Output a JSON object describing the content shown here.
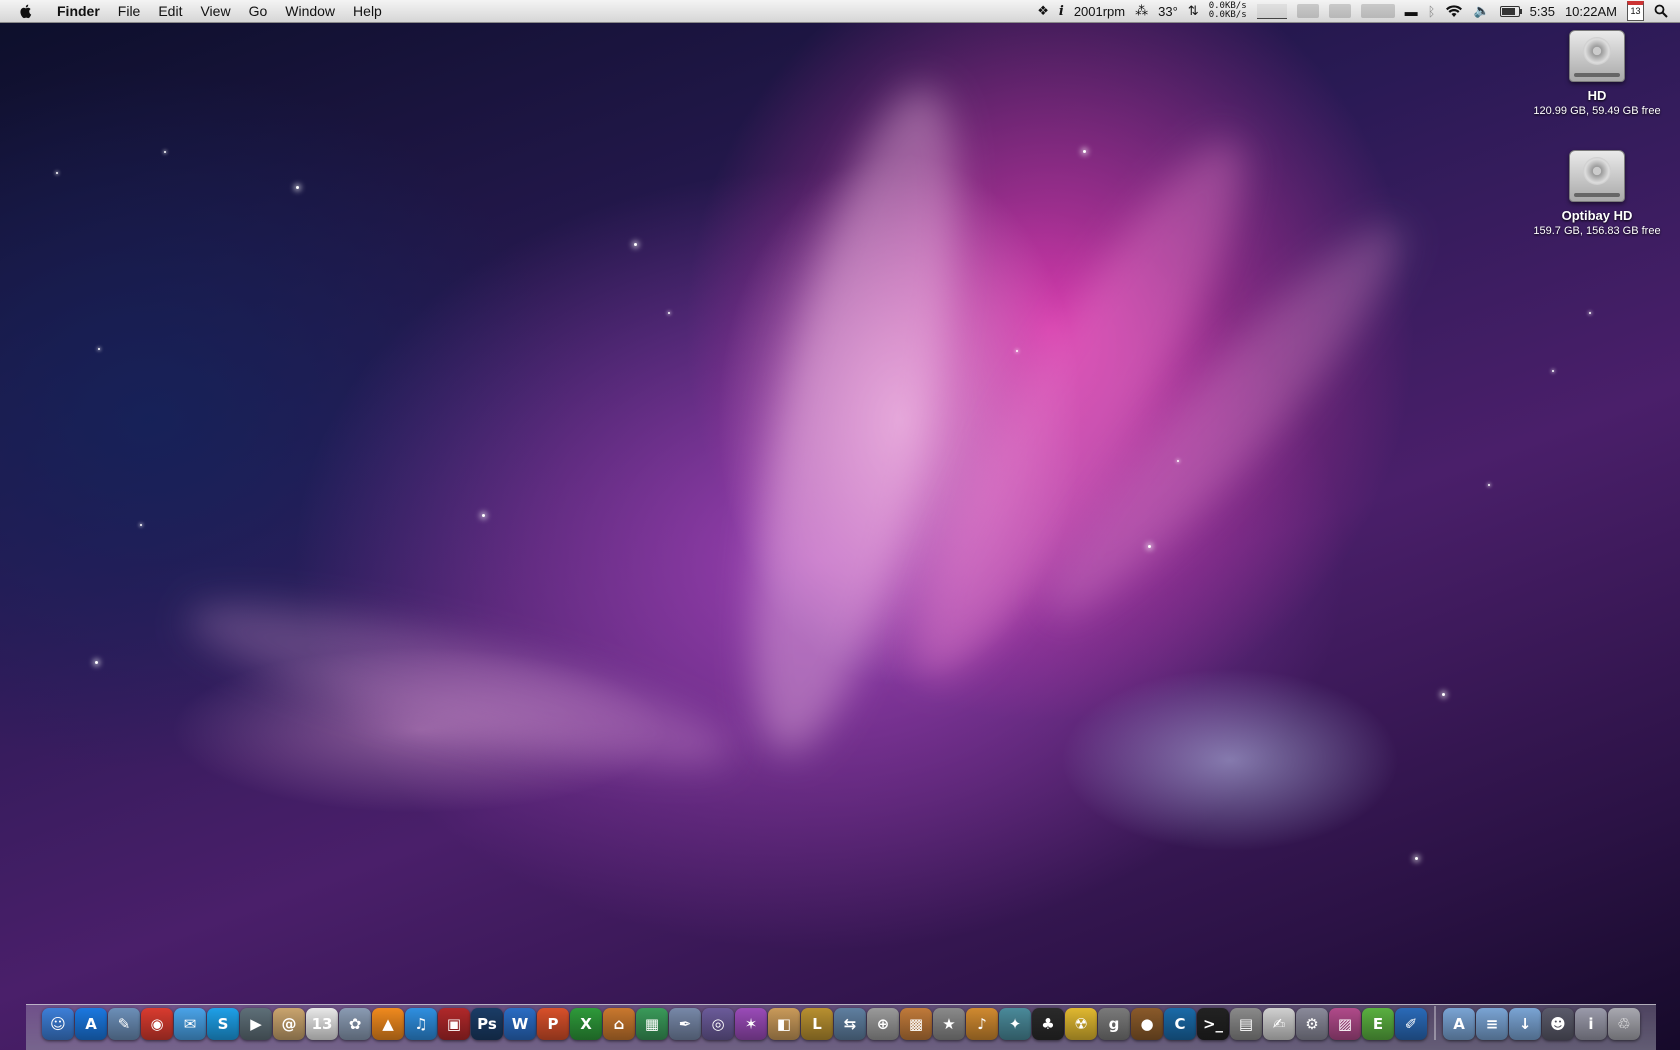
{
  "menubar": {
    "app_name": "Finder",
    "menus": [
      "File",
      "Edit",
      "View",
      "Go",
      "Window",
      "Help"
    ],
    "status": {
      "fan_speed": "2001rpm",
      "temperature": "33°",
      "net_up": "0.0KB/s",
      "net_down": "0.0KB/s",
      "battery_time": "5:35",
      "clock": "10:22AM",
      "calendar_day": "13"
    }
  },
  "desktop_icons": [
    {
      "name": "HD",
      "info": "120.99 GB, 59.49 GB free"
    },
    {
      "name": "Optibay HD",
      "info": "159.7 GB, 156.83 GB free"
    }
  ],
  "dock": {
    "apps": [
      {
        "name": "finder-icon",
        "glyph": "☺",
        "color": "#3d7fd8"
      },
      {
        "name": "app-store-icon",
        "glyph": "A",
        "color": "#1b78e0"
      },
      {
        "name": "preview-icon",
        "glyph": "✎",
        "color": "#6c8fb8"
      },
      {
        "name": "chrome-icon",
        "glyph": "◉",
        "color": "#d93b2f"
      },
      {
        "name": "messages-icon",
        "glyph": "✉",
        "color": "#4aa3e8"
      },
      {
        "name": "skype-icon",
        "glyph": "S",
        "color": "#1ea0e8"
      },
      {
        "name": "facetime-icon",
        "glyph": "▶",
        "color": "#5e6f78"
      },
      {
        "name": "address-book-icon",
        "glyph": "@",
        "color": "#c9a46e"
      },
      {
        "name": "ical-icon",
        "glyph": "13",
        "color": "#e8e8e8"
      },
      {
        "name": "image-capture-icon",
        "glyph": "✿",
        "color": "#8a9bb3"
      },
      {
        "name": "vlc-icon",
        "glyph": "▲",
        "color": "#f08a1e"
      },
      {
        "name": "itunes-icon",
        "glyph": "♫",
        "color": "#2f8fe0"
      },
      {
        "name": "photo-booth-icon",
        "glyph": "▣",
        "color": "#b0282a"
      },
      {
        "name": "photoshop-icon",
        "glyph": "Ps",
        "color": "#1a3c66"
      },
      {
        "name": "word-icon",
        "glyph": "W",
        "color": "#2a6cc4"
      },
      {
        "name": "powerpoint-icon",
        "glyph": "P",
        "color": "#d8502a"
      },
      {
        "name": "excel-icon",
        "glyph": "X",
        "color": "#2e9a3a"
      },
      {
        "name": "keynote-icon",
        "glyph": "⌂",
        "color": "#c9782e"
      },
      {
        "name": "numbers-icon",
        "glyph": "▦",
        "color": "#3a9a5a"
      },
      {
        "name": "pages-icon",
        "glyph": "✒",
        "color": "#7788a8"
      },
      {
        "name": "aperture-icon",
        "glyph": "◎",
        "color": "#6b5b9a"
      },
      {
        "name": "imovie-icon",
        "glyph": "✶",
        "color": "#9a4bb8"
      },
      {
        "name": "archive-utility-icon",
        "glyph": "◧",
        "color": "#c99a5a"
      },
      {
        "name": "league-icon",
        "glyph": "L",
        "color": "#b89030"
      },
      {
        "name": "transmit-icon",
        "glyph": "⇆",
        "color": "#5f7fa0"
      },
      {
        "name": "disk-utility-icon",
        "glyph": "⊕",
        "color": "#9a9a9a"
      },
      {
        "name": "iphoto-icon",
        "glyph": "▩",
        "color": "#c07a3a"
      },
      {
        "name": "imovie-star-icon",
        "glyph": "★",
        "color": "#8a8a8a"
      },
      {
        "name": "garageband-icon",
        "glyph": "♪",
        "color": "#d08a30"
      },
      {
        "name": "maps-icon",
        "glyph": "✦",
        "color": "#4a8a9a"
      },
      {
        "name": "card-game-icon",
        "glyph": "♣",
        "color": "#2a2a2a"
      },
      {
        "name": "radiation-icon",
        "glyph": "☢",
        "color": "#e0b830"
      },
      {
        "name": "g-app-icon",
        "glyph": "g",
        "color": "#7a7a7a"
      },
      {
        "name": "coconut-icon",
        "glyph": "●",
        "color": "#8a5a2a"
      },
      {
        "name": "crescent-icon",
        "glyph": "C",
        "color": "#1a6aa8"
      },
      {
        "name": "terminal-icon",
        "glyph": ">_",
        "color": "#222222"
      },
      {
        "name": "printer-icon",
        "glyph": "▤",
        "color": "#8a8a8a"
      },
      {
        "name": "textedit-icon",
        "glyph": "✍",
        "color": "#d0d0d0"
      },
      {
        "name": "system-preferences-icon",
        "glyph": "⚙",
        "color": "#8a8a9a"
      },
      {
        "name": "desktop-wallpaper-icon",
        "glyph": "▨",
        "color": "#b04a8a"
      },
      {
        "name": "evernote-icon",
        "glyph": "E",
        "color": "#5ab040"
      },
      {
        "name": "xcode-icon",
        "glyph": "✐",
        "color": "#2a6ab8"
      }
    ],
    "stacks": [
      {
        "name": "applications-folder-icon",
        "glyph": "A",
        "color": "#7aa4d4"
      },
      {
        "name": "documents-folder-icon",
        "glyph": "≡",
        "color": "#7aa4d4"
      },
      {
        "name": "downloads-folder-icon",
        "glyph": "↓",
        "color": "#7aa4d4"
      },
      {
        "name": "user-folder-icon",
        "glyph": "☻",
        "color": "#5a5a6a"
      },
      {
        "name": "info-icon",
        "glyph": "i",
        "color": "#9a9aaa"
      },
      {
        "name": "trash-icon",
        "glyph": "♲",
        "color": "#a8a8b0"
      }
    ]
  }
}
